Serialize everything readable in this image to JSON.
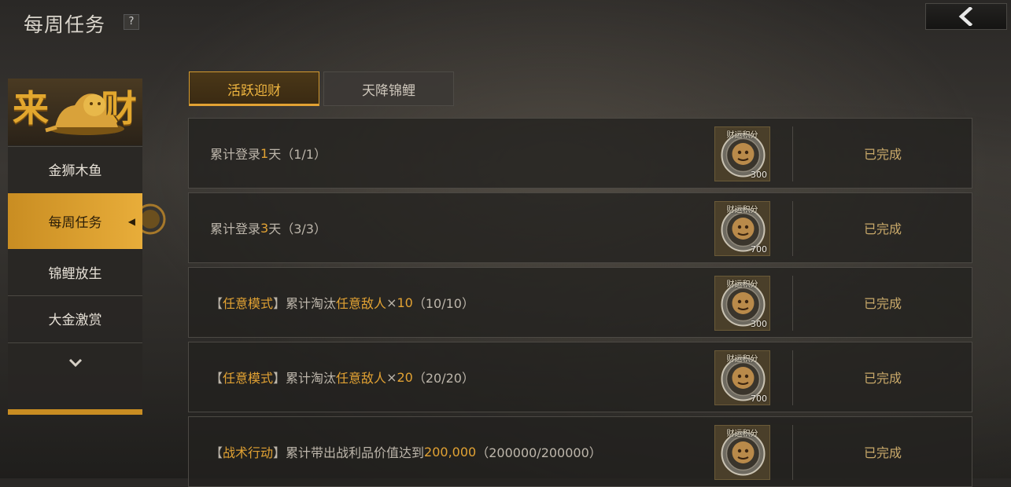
{
  "header": {
    "title": "每周任务",
    "help_label": "?"
  },
  "sidebar": {
    "banner_text": "来财",
    "items": [
      {
        "label": "金狮木鱼"
      },
      {
        "label": "每周任务"
      },
      {
        "label": "锦鲤放生"
      },
      {
        "label": "大金激赏"
      }
    ]
  },
  "tabs": [
    {
      "label": "活跃迎财"
    },
    {
      "label": "天降锦鲤"
    }
  ],
  "tasks": [
    {
      "p1": "累计登录",
      "h1": "1",
      "p2": "天",
      "h2": "",
      "p3": "",
      "h3": "",
      "progress": "（1/1）",
      "reward_label": "财运积分",
      "reward_amount": "300",
      "status": "已完成"
    },
    {
      "p1": "累计登录",
      "h1": "3",
      "p2": "天",
      "h2": "",
      "p3": "",
      "h3": "",
      "progress": "（3/3）",
      "reward_label": "财运积分",
      "reward_amount": "700",
      "status": "已完成"
    },
    {
      "p1": "【 ",
      "h1": "任意模式",
      "p2": " 】累计淘汰",
      "h2": "任意敌人",
      "p3": " ×",
      "h3": "10",
      "progress": "（10/10）",
      "reward_label": "财运积分",
      "reward_amount": "300",
      "status": "已完成"
    },
    {
      "p1": "【 ",
      "h1": "任意模式",
      "p2": " 】累计淘汰",
      "h2": "任意敌人",
      "p3": " ×",
      "h3": "20",
      "progress": "（20/20）",
      "reward_label": "财运积分",
      "reward_amount": "700",
      "status": "已完成"
    },
    {
      "p1": "【 ",
      "h1": "战术行动",
      "p2": " 】累计带出战利品价值达到",
      "h2": "200,000",
      "p3": "",
      "h3": "",
      "progress": "（200000/200000）",
      "reward_label": "财运积分",
      "reward_amount": "",
      "status": "已完成"
    }
  ],
  "colors": {
    "accent": "#e2a233",
    "status": "#c9a96a"
  },
  "icons": {
    "back": "chevron-left-icon",
    "scroll": "chevron-down-icon",
    "reward": "lion-coin-icon"
  }
}
